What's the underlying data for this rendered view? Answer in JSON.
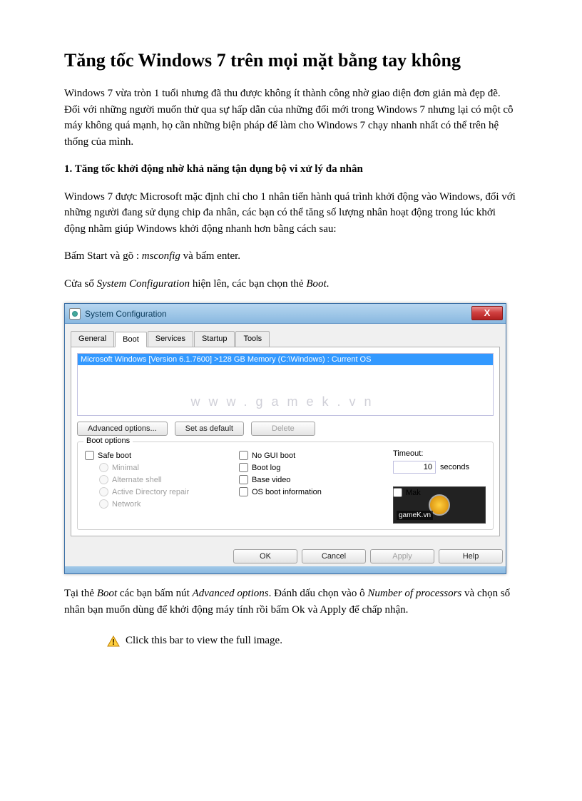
{
  "title": "Tăng tốc Windows 7 trên mọi mặt bằng tay không",
  "para1": "Windows 7 vừa tròn 1 tuổi nhưng đã thu được không ít thành công nhờ giao diện đơn giản mà đẹp đẽ. Đối với những người muốn thử qua sự hấp dẫn của những đổi mới trong Windows 7 nhưng lại có một cỗ máy không quá mạnh, họ cần những biện pháp để làm cho Windows 7 chạy nhanh nhất có thể trên hệ thống của mình.",
  "heading1": "1. Tăng tốc khởi động nhờ khả năng tận dụng bộ vi xử lý đa nhân",
  "para2": "Windows 7 được Microsoft mặc định chỉ cho 1 nhân tiến hành quá trình khởi động vào Windows, đối với những người đang sử dụng chip đa nhân, các bạn có thể tăng số lượng nhân hoạt động trong lúc khởi động nhằm giúp Windows khởi động nhanh hơn bằng cách sau:",
  "para3_a": "Bấm Start và gõ : ",
  "para3_b": "msconfig",
  "para3_c": " và bấm enter.",
  "para4_a": "Cửa sổ ",
  "para4_b": "System Configuration",
  "para4_c": " hiện lên, các bạn chọn thẻ ",
  "para4_d": "Boot",
  "para4_e": ".",
  "window": {
    "title": "System Configuration",
    "close": "X",
    "tabs": [
      "General",
      "Boot",
      "Services",
      "Startup",
      "Tools"
    ],
    "list_item": "Microsoft Windows [Version 6.1.7600] >128 GB Memory (C:\\Windows) : Current OS",
    "watermark": "www.gamek.vn",
    "btn_adv": "Advanced options...",
    "btn_setdef": "Set as default",
    "btn_del": "Delete",
    "group_title": "Boot options",
    "chk_safe": "Safe boot",
    "rad_min": "Minimal",
    "rad_alt": "Alternate shell",
    "rad_ad": "Active Directory repair",
    "rad_net": "Network",
    "chk_nogui": "No GUI boot",
    "chk_log": "Boot log",
    "chk_basevid": "Base video",
    "chk_osinfo": "OS boot information",
    "timeout_label": "Timeout:",
    "timeout_val": "10",
    "timeout_unit": "seconds",
    "chk_make": "Mak",
    "badge": "gameK.vn",
    "btn_ok": "OK",
    "btn_cancel": "Cancel",
    "btn_apply": "Apply",
    "btn_help": "Help"
  },
  "para5_a": "Tại thẻ ",
  "para5_b": "Boot",
  "para5_c": " các bạn bấm nút ",
  "para5_d": "Advanced options",
  "para5_e": ". Đánh dấu chọn vào ô ",
  "para5_f": "Number of processors",
  "para5_g": " và chọn số nhân bạn muốn dùng để khởi động máy tính rồi bấm Ok và Apply để chấp nhận.",
  "info_bar": "Click this bar to view the full image."
}
